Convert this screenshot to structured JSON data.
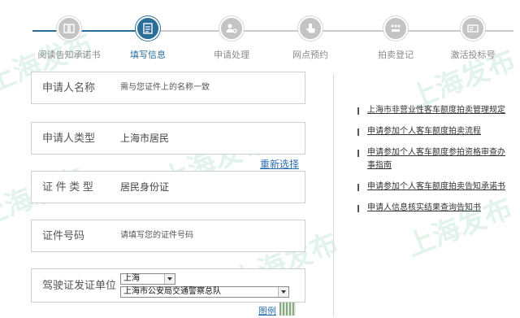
{
  "steps": [
    {
      "label": "阅读告知承诺书",
      "icon": "book-icon"
    },
    {
      "label": "填写信息",
      "icon": "form-icon"
    },
    {
      "label": "申请处理",
      "icon": "user-gear-icon"
    },
    {
      "label": "网点预约",
      "icon": "hand-pointer-icon"
    },
    {
      "label": "拍卖登记",
      "icon": "dots-grid-icon"
    },
    {
      "label": "激活投标号",
      "icon": "id-card-icon"
    }
  ],
  "active_step": "填写信息",
  "form": {
    "applicant_name": {
      "label": "申请人名称",
      "value": "需与您证件上的名称一致"
    },
    "applicant_type": {
      "label": "申请人类型",
      "value": "上海市居民"
    },
    "reselect_link": "重新选择",
    "id_type": {
      "label": "证 件 类 型",
      "value": "居民身份证"
    },
    "id_number": {
      "label": "证件号码",
      "placeholder": "请填写您的证件号码"
    },
    "license_issuer": {
      "label": "驾驶证发证单位",
      "city": "上海",
      "unit": "上海市公安局交通警察总队"
    },
    "example_link": "图例"
  },
  "side_links": [
    "上海市非营业性客车额度拍卖管理规定",
    "申请参加个人客车额度拍卖流程",
    "申请参加个人客车额度参拍资格审查办事指南",
    "申请参加个人客车额度拍卖告知承诺书",
    "申请人信息核实结果查询告知书"
  ],
  "watermark": "上海发布",
  "colors": {
    "accent": "#2c6e9a",
    "link": "#2d6fb0",
    "inactive": "#c4c4c4"
  }
}
